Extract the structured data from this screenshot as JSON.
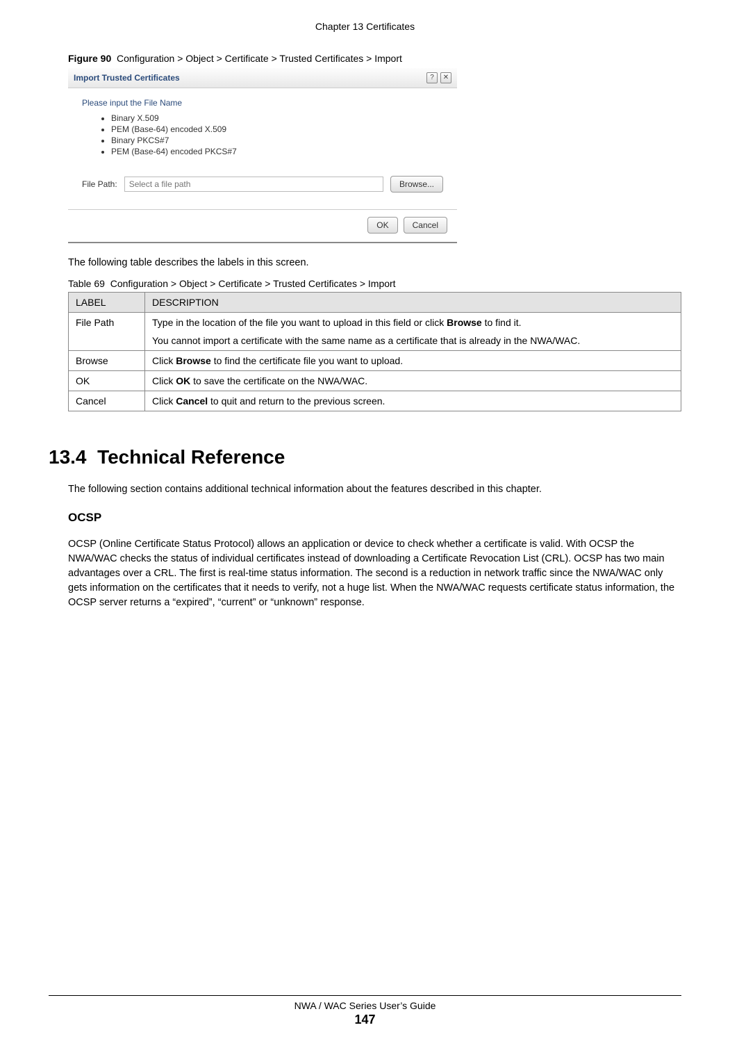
{
  "header": {
    "chapter": "Chapter 13 Certificates"
  },
  "figure": {
    "label": "Figure 90",
    "caption": "Configuration > Object > Certificate > Trusted Certificates > Import",
    "dialog": {
      "title": "Import Trusted Certificates",
      "prompt": "Please input the File Name",
      "formats": [
        "Binary X.509",
        "PEM (Base-64) encoded X.509",
        "Binary PKCS#7",
        "PEM (Base-64) encoded PKCS#7"
      ],
      "filepath_label": "File Path:",
      "filepath_placeholder": "Select a file path",
      "browse_label": "Browse...",
      "ok_label": "OK",
      "cancel_label": "Cancel"
    }
  },
  "intro": "The following table describes the labels in this screen.",
  "table": {
    "caption_prefix": "Table 69",
    "caption_text": "Configuration > Object > Certificate > Trusted Certificates > Import",
    "headers": {
      "label": "LABEL",
      "description": "DESCRIPTION"
    },
    "rows": [
      {
        "label": "File Path",
        "desc_pre": "Type in the location of the file you want to upload in this field or click ",
        "desc_bold": "Browse",
        "desc_post": " to find it.",
        "desc_p2": "You cannot import a certificate with the same name as a certificate that is already in the NWA/WAC."
      },
      {
        "label": "Browse",
        "desc_pre": "Click ",
        "desc_bold": "Browse",
        "desc_post": " to find the certificate file you want to upload."
      },
      {
        "label": "OK",
        "desc_pre": "Click ",
        "desc_bold": "OK",
        "desc_post": " to save the certificate on the NWA/WAC."
      },
      {
        "label": "Cancel",
        "desc_pre": "Click ",
        "desc_bold": "Cancel",
        "desc_post": " to quit and return to the previous screen."
      }
    ]
  },
  "section": {
    "number": "13.4",
    "title": "Technical Reference",
    "intro": "The following section contains additional technical information about the features described in this chapter.",
    "subheading": "OCSP",
    "body": "OCSP (Online Certificate Status Protocol) allows an application or device to check whether a certificate is valid. With OCSP the NWA/WAC checks the status of individual certificates instead of downloading a Certificate Revocation List (CRL). OCSP has two main advantages over a CRL. The first is real-time status information. The second is a reduction in network traffic since the NWA/WAC only gets information on the certificates that it needs to verify, not a huge list. When the NWA/WAC requests certificate status information, the OCSP server returns a “expired”, “current” or “unknown” response."
  },
  "footer": {
    "guide": "NWA / WAC Series User’s Guide",
    "page": "147"
  }
}
